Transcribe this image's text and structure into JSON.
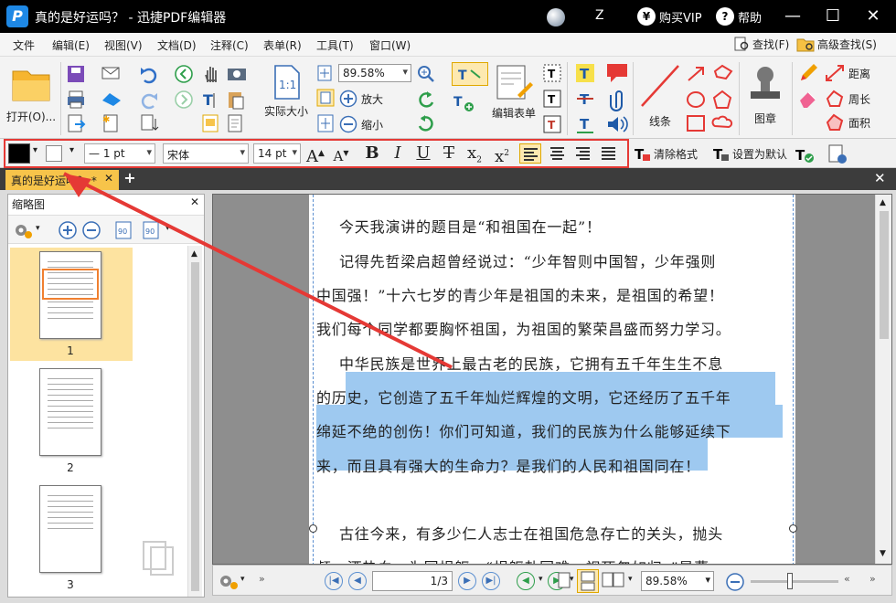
{
  "window": {
    "title": "真的是好运吗？ - 迅捷PDF编辑器",
    "user": "Z",
    "vip_label": "购买VIP",
    "help_label": "帮助"
  },
  "menu": [
    "文件",
    "编辑(E)",
    "视图(V)",
    "文档(D)",
    "注释(C)",
    "表单(R)",
    "工具(T)",
    "窗口(W)"
  ],
  "menu_right": {
    "find": "查找(F)",
    "advanced_find": "高级查找(S)"
  },
  "ribbon": {
    "open": "打开(O)...",
    "zoom_value": "89.58%",
    "actual_size": "实际大小",
    "zoom_in": "放大",
    "zoom_out": "缩小",
    "edit_form": "编辑表单",
    "lines": "线条",
    "stamp": "图章",
    "distance": "距离",
    "perimeter": "周长",
    "area": "面积"
  },
  "format": {
    "line_width": "1 pt",
    "font": "宋体",
    "font_size": "14 pt",
    "clear_format": "清除格式",
    "set_default": "设置为默认",
    "colors": {
      "text": "#000000",
      "highlight_box": "#e53935",
      "selection": "#9ec9f0"
    }
  },
  "tab": {
    "label": "真的是好运吗？ *"
  },
  "thumbnails": {
    "title": "缩略图",
    "pages": [
      "1",
      "2",
      "3"
    ]
  },
  "document": {
    "paragraphs": [
      "今天我演讲的题目是“和祖国在一起”！",
      "记得先哲梁启超曾经说过：“少年智则中国智，少年强则",
      "中国强！”十六七岁的青少年是祖国的未来，是祖国的希望！",
      "我们每个同学都要胸怀祖国，为祖国的繁荣昌盛而努力学习。",
      "中华民族是世界上最古老的民族，它拥有五千年生生不息",
      "的历史，它创造了五千年灿烂辉煌的文明，它还经历了五千年",
      "绵延不绝的创伤！你们可知道，我们的民族为什么能够延续下",
      "来，而且具有强大的生命力？是我们的人民和祖国同在！",
      "古往今来，有多少仁人志士在祖国危急存亡的关头，抛头",
      "颅，洒热血，为国捐躯。“捐躯赴国难，视死忽如归。”是曹"
    ]
  },
  "status": {
    "current_page": "1",
    "total_pages": "3",
    "zoom": "89.58%"
  }
}
